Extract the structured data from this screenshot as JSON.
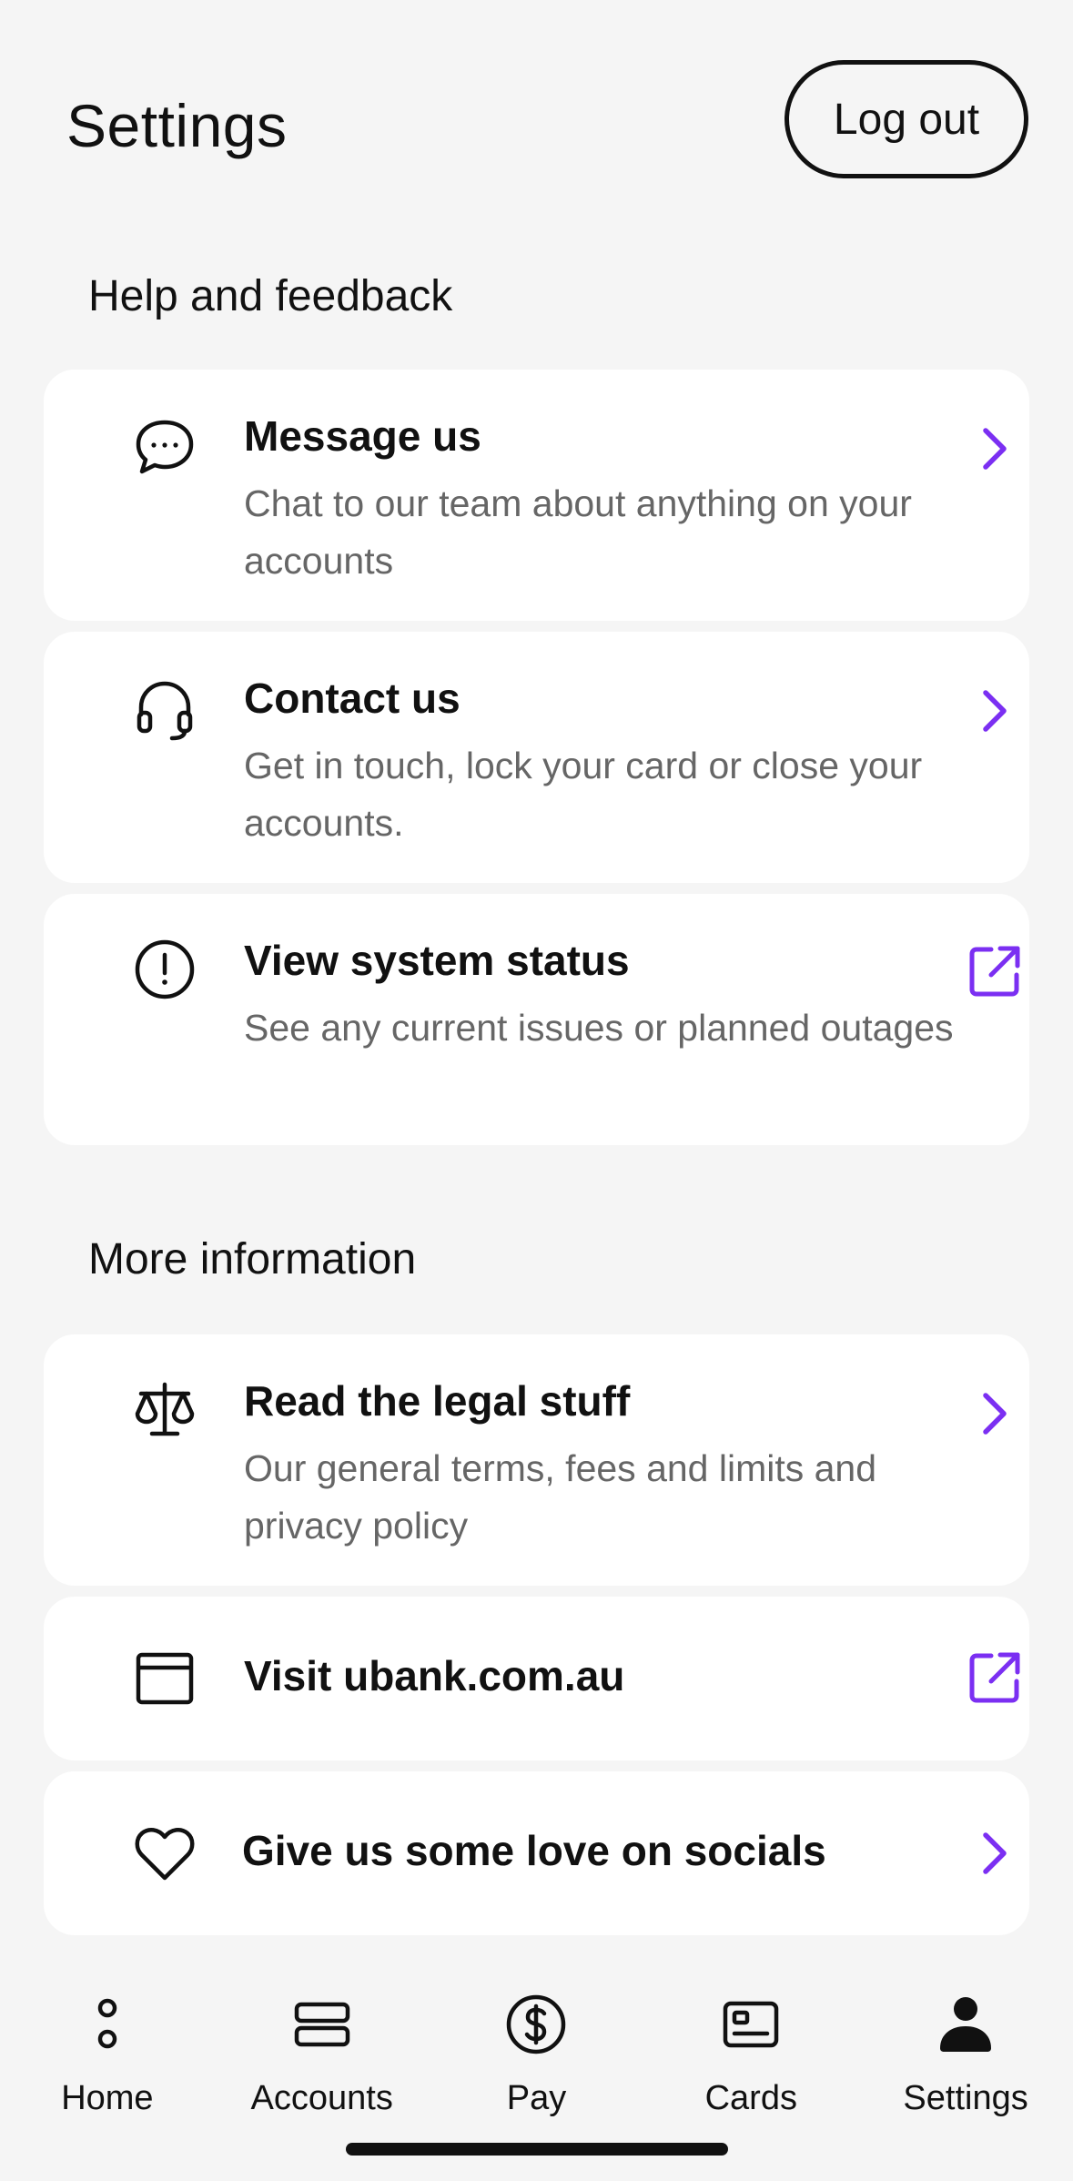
{
  "header": {
    "title": "Settings",
    "logout_label": "Log out"
  },
  "help_section": {
    "heading": "Help and feedback",
    "items": [
      {
        "icon": "chat-bubble-icon",
        "title": "Message us",
        "description": "Chat to our team about anything on your accounts",
        "trailing": "chevron-right-icon"
      },
      {
        "icon": "headset-icon",
        "title": "Contact us",
        "description": "Get in touch, lock your card or close your accounts.",
        "trailing": "chevron-right-icon"
      },
      {
        "icon": "alert-circle-icon",
        "title": "View system status",
        "description": "See any current issues or planned outages",
        "trailing": "external-link-icon"
      }
    ]
  },
  "info_section": {
    "heading": "More information",
    "items": [
      {
        "icon": "scales-icon",
        "title": "Read the legal stuff",
        "description": "Our general terms, fees and limits and privacy policy",
        "trailing": "chevron-right-icon"
      },
      {
        "icon": "browser-window-icon",
        "title": "Visit ubank.com.au",
        "trailing": "external-link-icon"
      },
      {
        "icon": "heart-icon",
        "title": "Give us some love on socials",
        "trailing": "chevron-right-icon"
      }
    ]
  },
  "nav": {
    "items": [
      {
        "label": "Home",
        "icon": "home-dots-icon"
      },
      {
        "label": "Accounts",
        "icon": "accounts-stack-icon"
      },
      {
        "label": "Pay",
        "icon": "dollar-circle-icon"
      },
      {
        "label": "Cards",
        "icon": "card-icon"
      },
      {
        "label": "Settings",
        "icon": "person-icon"
      }
    ],
    "active": "Settings"
  },
  "colors": {
    "accent": "#7b2ff2",
    "background": "#f5f5f5",
    "card": "#ffffff",
    "text": "#111111",
    "muted": "#666666"
  }
}
